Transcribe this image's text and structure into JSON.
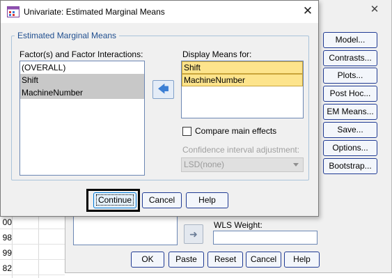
{
  "sheet": {
    "row_numbers": [
      "00",
      "98",
      "99",
      "82"
    ]
  },
  "parent_dialog": {
    "side_buttons": [
      "Model...",
      "Contrasts...",
      "Plots...",
      "Post Hoc...",
      "EM Means...",
      "Save...",
      "Options...",
      "Bootstrap..."
    ],
    "wls_label": "WLS Weight:",
    "bottom_buttons": [
      "OK",
      "Paste",
      "Reset",
      "Cancel",
      "Help"
    ]
  },
  "dialog": {
    "title": "Univariate: Estimated Marginal Means",
    "group_title": "Estimated Marginal Means",
    "factors_label": "Factor(s) and Factor Interactions:",
    "factors": [
      "(OVERALL)",
      "Shift",
      "MachineNumber"
    ],
    "display_label": "Display Means for:",
    "display_items": [
      "Shift",
      "MachineNumber"
    ],
    "compare_label": "Compare main effects",
    "compare_checked": false,
    "ci_label": "Confidence interval adjustment:",
    "ci_value": "LSD(none)",
    "buttons": {
      "continue": "Continue",
      "cancel": "Cancel",
      "help": "Help"
    }
  },
  "icons": {
    "app": "spss-dialog-icon",
    "close": "close-icon",
    "move": "arrow-left-icon",
    "bg_move": "arrow-right-icon",
    "dropdown": "chevron-down-icon"
  },
  "colors": {
    "accent_border": "#1f3a93",
    "group_title": "#1f4e8f",
    "selection_yellow": "#fde48c",
    "selection_grey": "#c8c8c8"
  }
}
